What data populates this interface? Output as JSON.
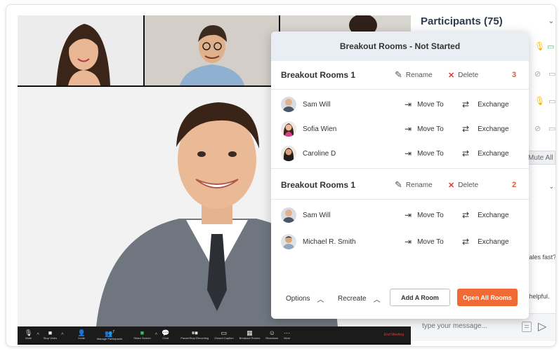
{
  "participants_panel": {
    "title": "Participants (75)",
    "mute_all_label": "Mute All",
    "chat_snippets": [
      "sales fast?",
      "l helpful."
    ],
    "chat_placeholder": "type your message..."
  },
  "modal": {
    "title": "Breakout Rooms - Not Started",
    "rename_label": "Rename",
    "delete_label": "Delete",
    "move_to_label": "Move To",
    "exchange_label": "Exchange",
    "rooms": [
      {
        "name": "Breakout Rooms 1",
        "count": "3",
        "participants": [
          "Sam Will",
          "Sofia Wien",
          "Caroline D"
        ]
      },
      {
        "name": "Breakout Rooms 1",
        "count": "2",
        "participants": [
          "Sam Will",
          "Michael R. Smith"
        ]
      }
    ],
    "footer": {
      "options_label": "Options",
      "recreate_label": "Recreate",
      "add_room_label": "Add A Room",
      "open_all_label": "Open All Rooms"
    }
  },
  "toolbar": {
    "items": [
      "Mute",
      "Stop Video",
      "Invite",
      "Manage Participants",
      "Share Screen",
      "Chat",
      "Pause/Stop Recording",
      "Closed Caption",
      "Breakout Rooms",
      "Reactions",
      "More"
    ],
    "end_label": "End Meeting",
    "participant_count_badge": "7"
  },
  "colors": {
    "accent_orange": "#f06a35",
    "delete_red": "#e0392b",
    "mic_yellow": "#f0b400",
    "video_green": "#3cbf54"
  }
}
